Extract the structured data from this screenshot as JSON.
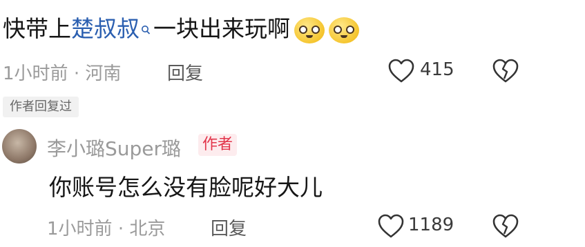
{
  "comment": {
    "text_before": "快带上",
    "mention": "楚叔叔",
    "text_after": "一块出来玩啊",
    "time": "1小时前",
    "location": "河南",
    "reply_label": "回复",
    "likes": "415",
    "emoji_icons": [
      "pleading-face-icon",
      "pleading-face-icon"
    ]
  },
  "author_replied_tag": "作者回复过",
  "reply": {
    "username": "李小璐Super璐",
    "badge": "作者",
    "text": "你账号怎么没有脸呢好大儿",
    "time": "1小时前",
    "location": "北京",
    "reply_label": "回复",
    "likes": "1189"
  },
  "colors": {
    "mention": "#2b5fb0",
    "badge_text": "#e2344a",
    "badge_bg": "#fdecee"
  }
}
